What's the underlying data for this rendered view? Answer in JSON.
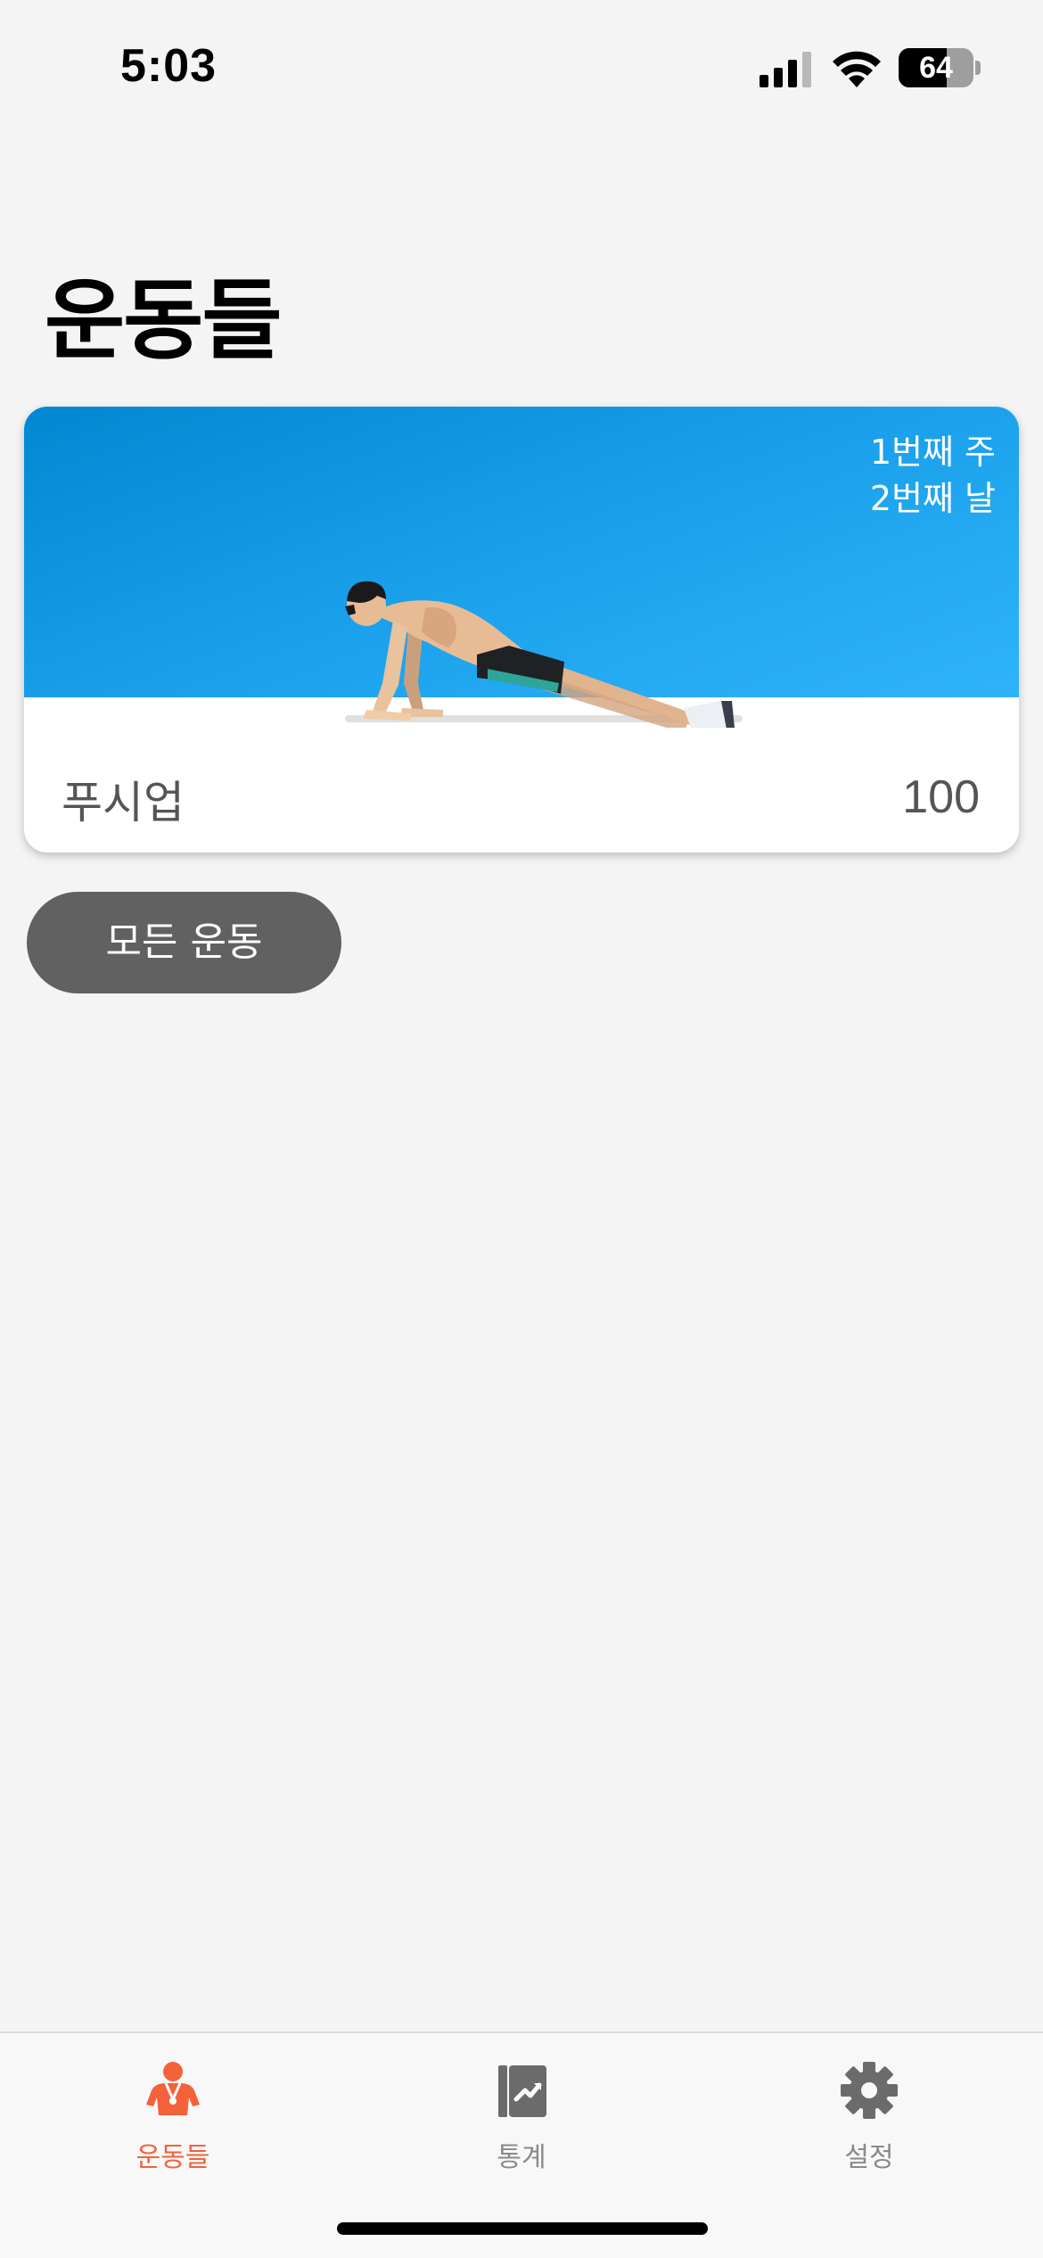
{
  "status_bar": {
    "time": "5:03",
    "battery_level": "64",
    "battery_fraction": 0.64
  },
  "header": {
    "title": "운동들"
  },
  "workout_card": {
    "week": "1번째 주",
    "day": "2번째 날",
    "exercise_name": "푸시업",
    "count": "100",
    "banner_color": "#1aa0ea"
  },
  "all_workouts_button": {
    "label": "모든 운동"
  },
  "tab_bar": {
    "accent_color": "#f4623a",
    "tabs": [
      {
        "label": "운동들",
        "icon": "person-trainer-icon",
        "active": true
      },
      {
        "label": "통계",
        "icon": "stats-chart-icon",
        "active": false
      },
      {
        "label": "설정",
        "icon": "gear-icon",
        "active": false
      }
    ]
  }
}
